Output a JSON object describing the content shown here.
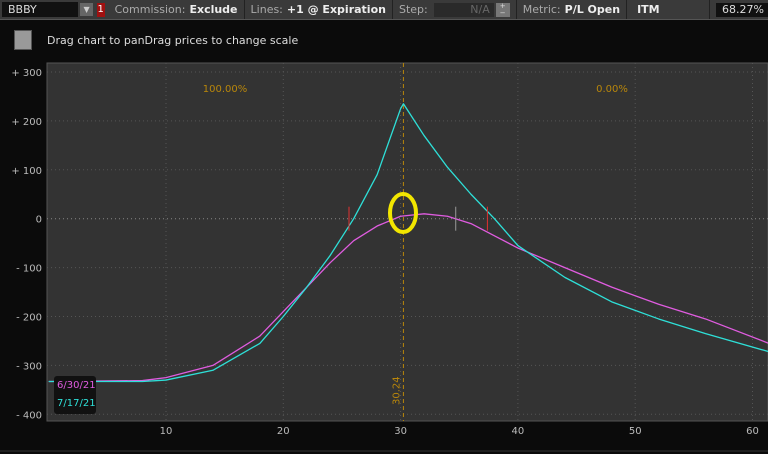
{
  "toolbar": {
    "symbol": "BBBY",
    "alert_count": "1",
    "commission_label": "Commission:",
    "commission_value": "Exclude",
    "lines_label": "Lines:",
    "lines_value": "+1 @ Expiration",
    "step_label": "Step:",
    "step_value": "N/A",
    "metric_label": "Metric:",
    "metric_value": "P/L Open",
    "itm_label": "ITM",
    "itm_value": "68.27%"
  },
  "hint": "Drag chart to panDrag prices to change scale",
  "chart_data": {
    "type": "line",
    "xlim": [
      0,
      61.4
    ],
    "ylim": [
      -430,
      310
    ],
    "x_ticks": [
      10,
      20,
      30,
      40,
      50,
      60
    ],
    "x_tick_labels": [
      "10",
      "20",
      "30",
      "40",
      "50",
      "60"
    ],
    "y_ticks": [
      300,
      200,
      100,
      0,
      -100,
      -200,
      -300,
      -400
    ],
    "y_tick_labels": [
      "+ 300",
      "+ 200",
      "+ 100",
      "0",
      "- 100",
      "- 200",
      "- 300",
      "- 400"
    ],
    "current_price": 30.24,
    "current_price_label": "30.24",
    "prob_left": "100.00%",
    "prob_right": "0.00%",
    "series": [
      {
        "name": "6/30/21",
        "color": "#e05ce0",
        "x": [
          0,
          8,
          10,
          14,
          18,
          20,
          22,
          24,
          26,
          28,
          30,
          32,
          34,
          36,
          38,
          40,
          44,
          48,
          52,
          56,
          61.4
        ],
        "y": [
          -333,
          -331,
          -325,
          -300,
          -240,
          -190,
          -140,
          -90,
          -45,
          -15,
          5,
          10,
          5,
          -10,
          -35,
          -60,
          -100,
          -140,
          -175,
          -205,
          -255
        ]
      },
      {
        "name": "7/17/21",
        "color": "#2ee0d8",
        "x": [
          0,
          8,
          10,
          14,
          18,
          20,
          22,
          24,
          26,
          28,
          30,
          30.24,
          32,
          34,
          36,
          38,
          40,
          44,
          48,
          52,
          56,
          61.4
        ],
        "y": [
          -333,
          -333,
          -330,
          -310,
          -255,
          -200,
          -140,
          -75,
          0,
          90,
          225,
          235,
          170,
          105,
          50,
          0,
          -55,
          -120,
          -170,
          -205,
          -235,
          -272
        ]
      }
    ],
    "markers": {
      "red": [
        25.6,
        37.4
      ],
      "grey": [
        34.7
      ]
    }
  }
}
